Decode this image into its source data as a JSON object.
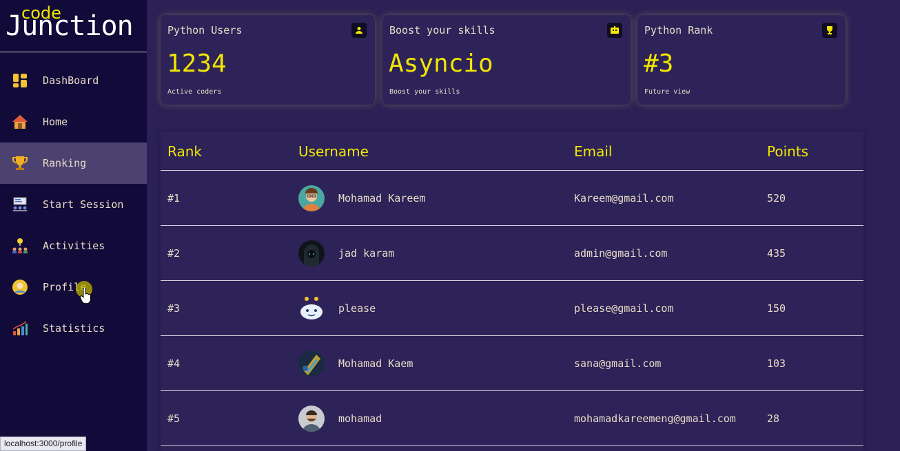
{
  "app": {
    "logo_small": "code",
    "logo_big": "Junction"
  },
  "sidebar": {
    "items": [
      {
        "label": "DashBoard",
        "icon": "dashboard-icon"
      },
      {
        "label": "Home",
        "icon": "house-icon"
      },
      {
        "label": "Ranking",
        "icon": "trophy-icon",
        "active": true
      },
      {
        "label": "Start Session",
        "icon": "classroom-icon"
      },
      {
        "label": "Activities",
        "icon": "team-idea-icon"
      },
      {
        "label": "Profile",
        "icon": "user-icon"
      },
      {
        "label": "Statistics",
        "icon": "bar-chart-icon"
      }
    ]
  },
  "cards": [
    {
      "title": "Python Users",
      "value": "1234",
      "sub": "Active coders",
      "icon": "user-icon"
    },
    {
      "title": "Boost your skills",
      "value": "Asyncio",
      "sub": "Boost your skills",
      "icon": "robot-icon"
    },
    {
      "title": "Python Rank",
      "value": "#3",
      "sub": "Future view",
      "icon": "trophy-icon"
    }
  ],
  "table": {
    "headers": {
      "rank": "Rank",
      "username": "Username",
      "email": "Email",
      "points": "Points"
    },
    "rows": [
      {
        "rank": "#1",
        "username": "Mohamad Kareem",
        "email": "Kareem@gmail.com",
        "points": "520"
      },
      {
        "rank": "#2",
        "username": "jad karam",
        "email": "admin@gmail.com",
        "points": "435"
      },
      {
        "rank": "#3",
        "username": "please",
        "email": "please@gmail.com",
        "points": "150"
      },
      {
        "rank": "#4",
        "username": "Mohamad Kaem",
        "email": "sana@gmail.com",
        "points": "103"
      },
      {
        "rank": "#5",
        "username": "mohamad",
        "email": "mohamadkareemeng@gmail.com",
        "points": "28"
      }
    ]
  },
  "status_url": "localhost:3000/profile",
  "colors": {
    "accent": "#f2e600",
    "background": "#2b2156",
    "sidebar": "#120a38",
    "active": "#4b4270"
  }
}
